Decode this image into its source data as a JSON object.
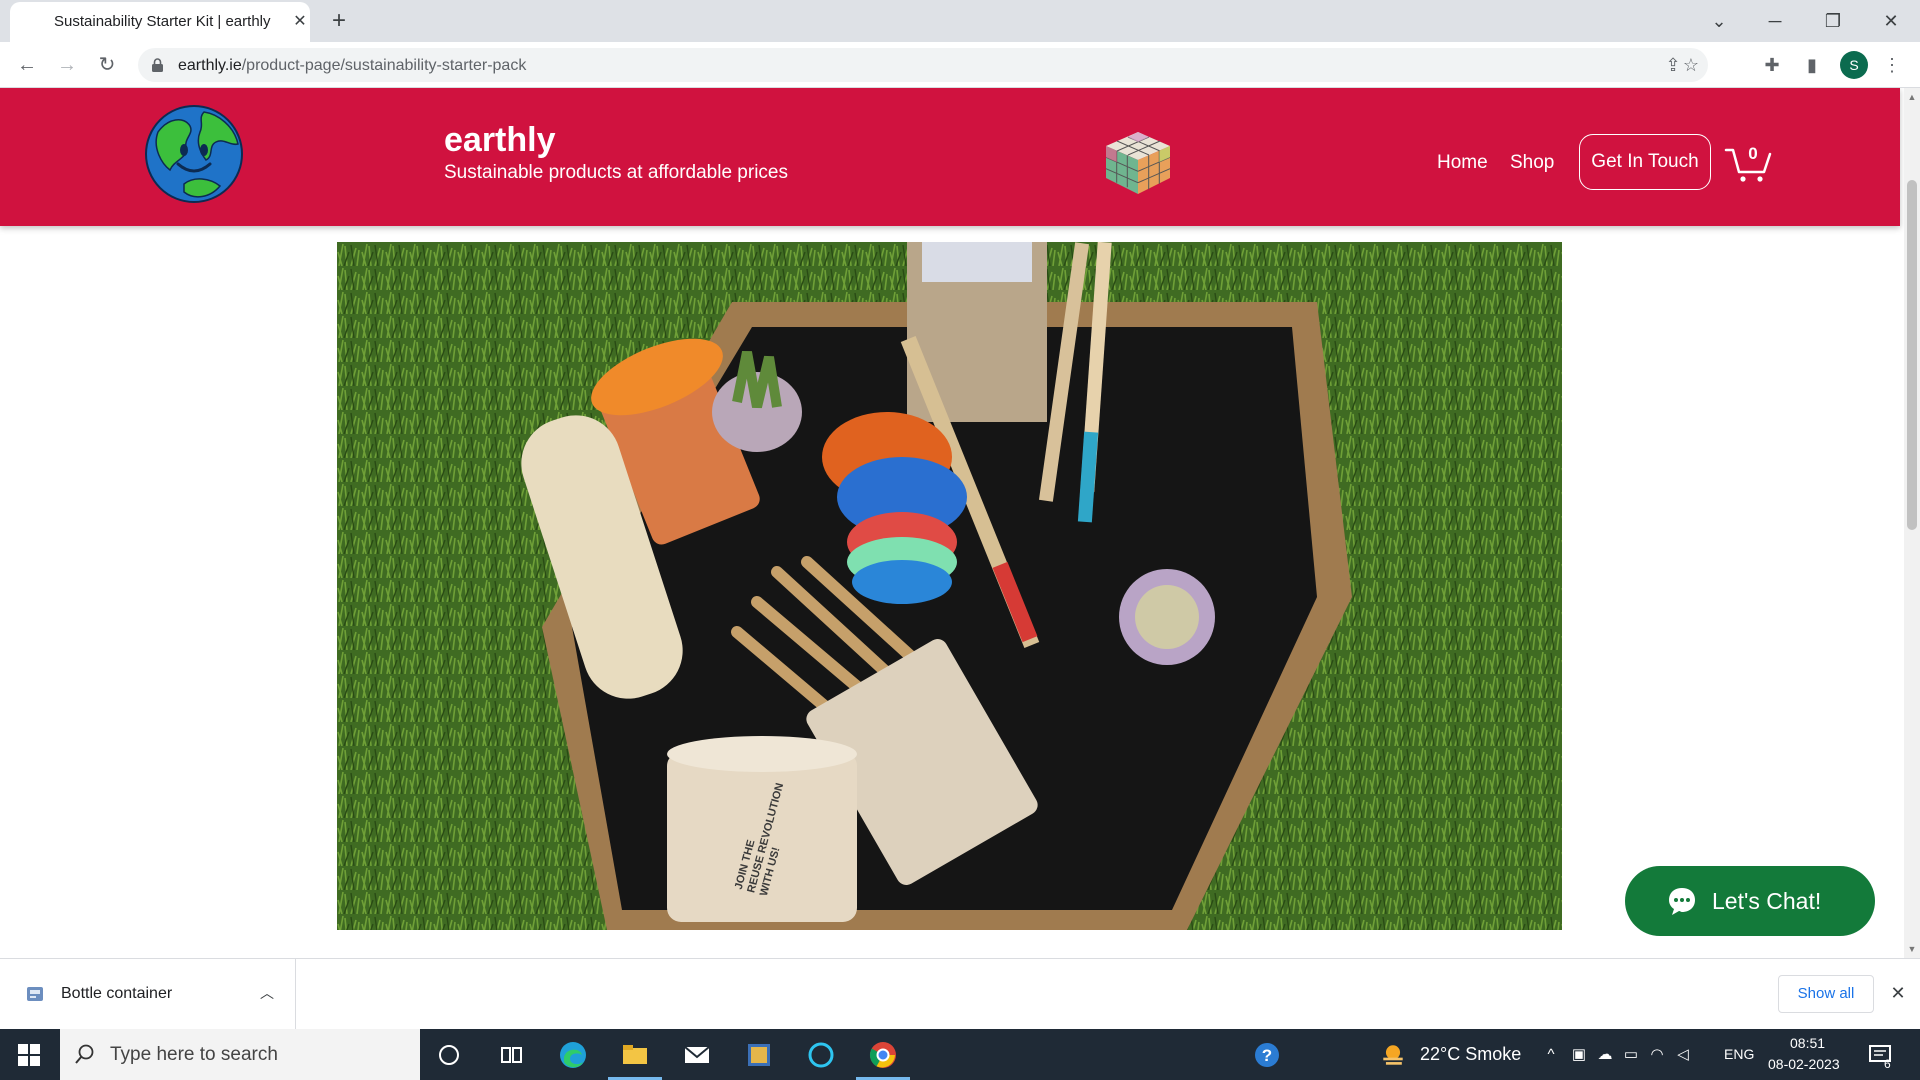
{
  "browser": {
    "tab_title": "Sustainability Starter Kit | earthly",
    "url_host": "earthly.ie",
    "url_path": "/product-page/sustainability-starter-pack",
    "profile_initial": "S"
  },
  "header": {
    "brand": "earthly",
    "tagline": "Sustainable products at affordable prices",
    "nav": [
      "Home",
      "Shop"
    ],
    "cta": "Get In Touch",
    "cart_count": "0",
    "header_color": "#d0123f"
  },
  "hero": {
    "slide_count": 7,
    "active_slide": 1,
    "cup_print": [
      "JOIN THE",
      "REUSE REVOLUTION",
      "WITH US!"
    ]
  },
  "chat": {
    "label": "Let's Chat!",
    "color": "#137a3a"
  },
  "downloads": {
    "file_name": "Bottle container",
    "show_all": "Show all"
  },
  "taskbar": {
    "search_placeholder": "Type here to search",
    "weather": "22°C  Smoke",
    "language": "ENG",
    "time": "08:51",
    "date": "08-02-2023",
    "notifications": "6"
  }
}
